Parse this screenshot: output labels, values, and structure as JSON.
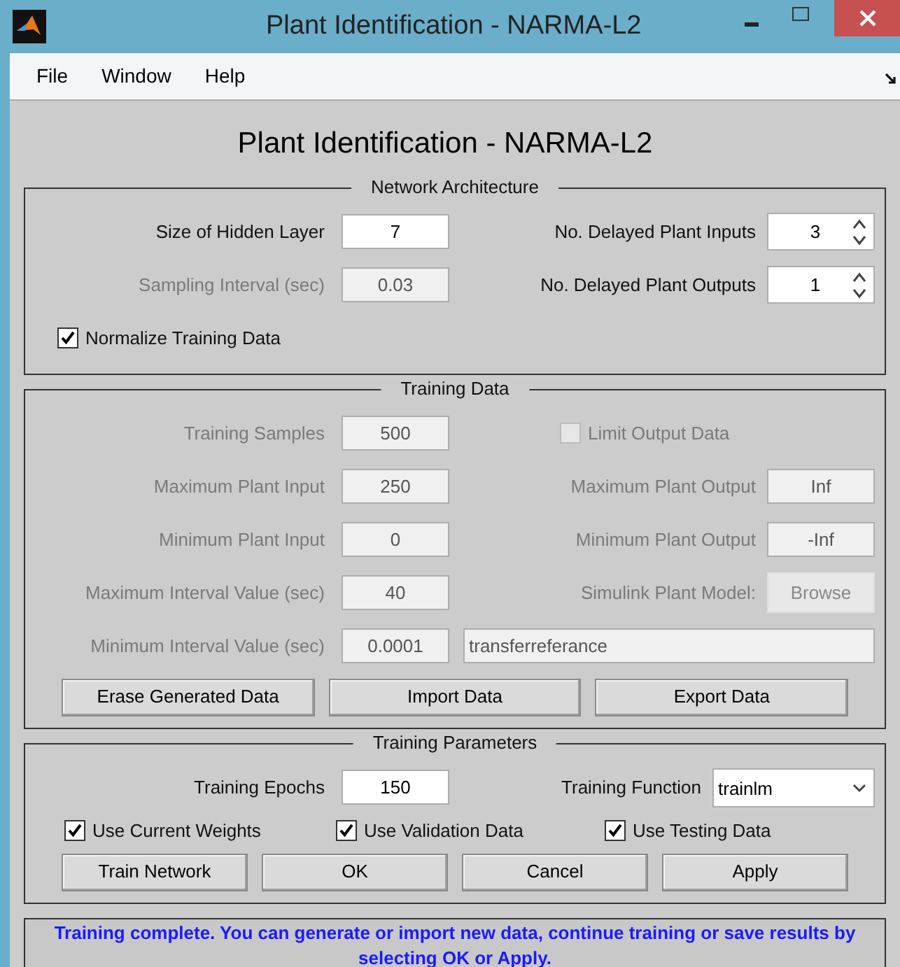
{
  "window": {
    "title": "Plant Identification - NARMA-L2"
  },
  "menu": [
    "File",
    "Window",
    "Help"
  ],
  "heading": "Plant Identification - NARMA-L2",
  "panels": [
    {
      "title": "Network Architecture",
      "rows": [
        {
          "left": {
            "kind": "field",
            "label": "Size of Hidden Layer",
            "value": "7",
            "disabled": false
          },
          "right": {
            "kind": "spinner",
            "label": "No. Delayed Plant Inputs",
            "value": "3"
          }
        },
        {
          "left": {
            "kind": "field",
            "label": "Sampling Interval (sec)",
            "value": "0.03",
            "disabled": true
          },
          "right": {
            "kind": "spinner",
            "label": "No. Delayed Plant Outputs",
            "value": "1"
          }
        },
        {
          "left": {
            "kind": "checkbox",
            "label": "Normalize Training Data",
            "checked": true,
            "disabled": false
          }
        }
      ]
    },
    {
      "title": "Training Data",
      "rows": [
        {
          "left": {
            "kind": "field",
            "label": "Training Samples",
            "value": "500",
            "disabled": true
          },
          "right": {
            "kind": "checkbox",
            "label": "Limit Output Data",
            "checked": false,
            "disabled": true
          }
        },
        {
          "left": {
            "kind": "field",
            "label": "Maximum Plant Input",
            "value": "250",
            "disabled": true
          },
          "right": {
            "kind": "field",
            "label": "Maximum Plant Output",
            "value": "Inf",
            "disabled": true
          }
        },
        {
          "left": {
            "kind": "field",
            "label": "Minimum Plant Input",
            "value": "0",
            "disabled": true
          },
          "right": {
            "kind": "field",
            "label": "Minimum Plant Output",
            "value": "-Inf",
            "disabled": true
          }
        },
        {
          "left": {
            "kind": "field",
            "label": "Maximum Interval Value (sec)",
            "value": "40",
            "disabled": true
          },
          "right": {
            "kind": "button",
            "label": "Simulink Plant Model:",
            "text": "Browse",
            "disabled": true
          }
        },
        {
          "left": {
            "kind": "field",
            "label": "Minimum Interval Value (sec)",
            "value": "0.0001",
            "disabled": true
          },
          "right": {
            "kind": "text_field",
            "value": "transferreferance",
            "disabled": true
          }
        }
      ],
      "buttons": [
        "Erase Generated Data",
        "Import Data",
        "Export Data"
      ]
    },
    {
      "title": "Training Parameters",
      "rows": [
        {
          "left": {
            "kind": "field",
            "label": "Training Epochs",
            "value": "150",
            "disabled": false
          },
          "right": {
            "kind": "dropdown",
            "label": "Training Function",
            "value": "trainlm"
          }
        }
      ],
      "checkboxes": [
        {
          "label": "Use Current Weights",
          "checked": true
        },
        {
          "label": "Use Validation Data",
          "checked": true
        },
        {
          "label": "Use Testing Data",
          "checked": true
        }
      ],
      "buttons": [
        "Train Network",
        "OK",
        "Cancel",
        "Apply"
      ]
    }
  ],
  "status": "Training complete. You can generate or import new data, continue training or save results by selecting OK or Apply."
}
